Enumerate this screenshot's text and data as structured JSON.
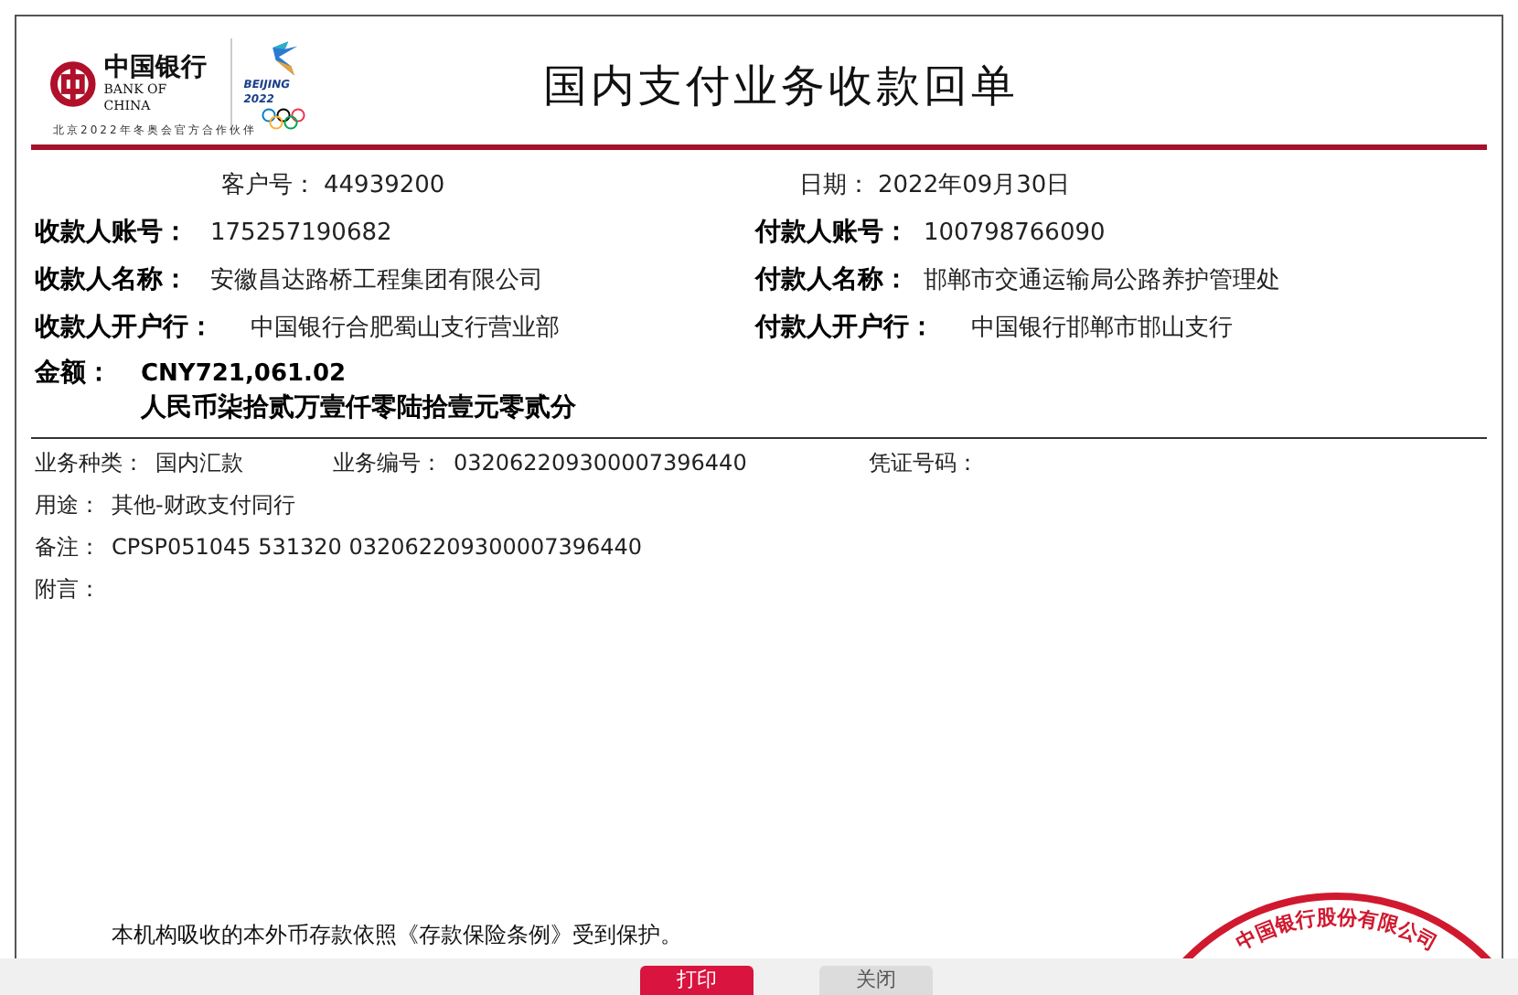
{
  "header": {
    "bank_logo": {
      "name_cn": "中国银行",
      "name_en": "BANK OF CHINA"
    },
    "olympic_logo": {
      "text": "BEIJING 2022"
    },
    "partner_note": "北京2022年冬奥会官方合作伙伴",
    "title": "国内支付业务收款回单"
  },
  "customer_no": {
    "label": "客户号：",
    "value": "44939200"
  },
  "date": {
    "label": "日期：",
    "value": "2022年09月30日"
  },
  "parties": [
    {
      "left": {
        "label": "收款人账号：",
        "value": "175257190682"
      },
      "right": {
        "label": "付款人账号：",
        "value": "100798766090"
      }
    },
    {
      "left": {
        "label": "收款人名称：",
        "value": "安徽昌达路桥工程集团有限公司"
      },
      "right": {
        "label": "付款人名称：",
        "value": "邯郸市交通运输局公路养护管理处"
      }
    },
    {
      "left": {
        "label": "收款人开户行：",
        "value": "中国银行合肥蜀山支行营业部"
      },
      "right": {
        "label": "付款人开户行：",
        "value": "中国银行邯郸市邯山支行"
      }
    }
  ],
  "amount": {
    "label": "金额：",
    "figures": "CNY721,061.02",
    "words": "人民币柒拾贰万壹仟零陆拾壹元零贰分"
  },
  "details": [
    [
      {
        "label": "业务种类：",
        "value": "国内汇款"
      },
      {
        "label": "业务编号：",
        "value": "032062209300007396440"
      },
      {
        "label": "凭证号码："
      }
    ],
    [
      {
        "label": "用途：",
        "value": "其他-财政支付同行"
      }
    ],
    [
      {
        "label": "备注：",
        "value": "CPSP051045 531320 032062209300007396440"
      }
    ],
    [
      {
        "label": "附言："
      }
    ]
  ],
  "notice": "本机构吸收的本外币存款依照《存款保险条例》受到保护。",
  "stamp": {
    "text": "中国银行股份有限公司"
  },
  "buttons": [
    {
      "label": "打印",
      "kind": "primary"
    },
    {
      "label": "关闭",
      "kind": "secondary"
    }
  ]
}
